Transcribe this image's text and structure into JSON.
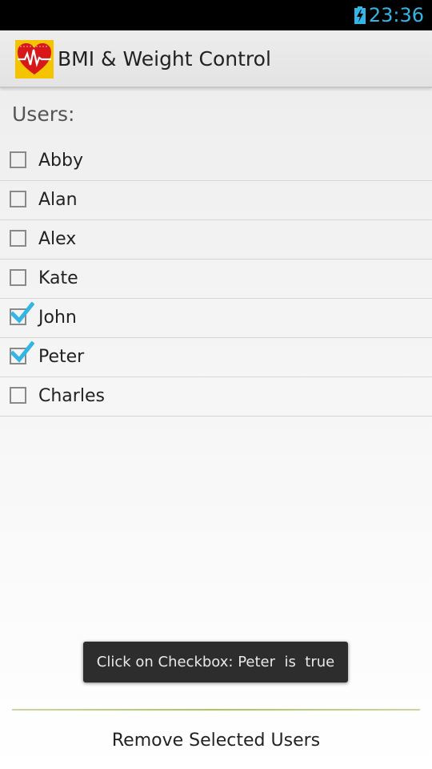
{
  "status_bar": {
    "time": "23:36",
    "battery_icon": "battery-charging-icon",
    "accent_color": "#33b5e5"
  },
  "action_bar": {
    "app_icon": "heart-pulse-icon",
    "title": "BMI & Weight Control"
  },
  "users_section": {
    "title": "Users:",
    "items": [
      {
        "name": "Abby",
        "checked": false
      },
      {
        "name": "Alan",
        "checked": false
      },
      {
        "name": "Alex",
        "checked": false
      },
      {
        "name": "Kate",
        "checked": false
      },
      {
        "name": "John",
        "checked": true
      },
      {
        "name": "Peter",
        "checked": true
      },
      {
        "name": "Charles",
        "checked": false
      }
    ]
  },
  "toast": {
    "message": "Click on Checkbox: Peter  is  true"
  },
  "footer": {
    "remove_label": "Remove Selected Users"
  },
  "colors": {
    "checkmark": "#33b5e5",
    "divider": "#a8c860"
  }
}
